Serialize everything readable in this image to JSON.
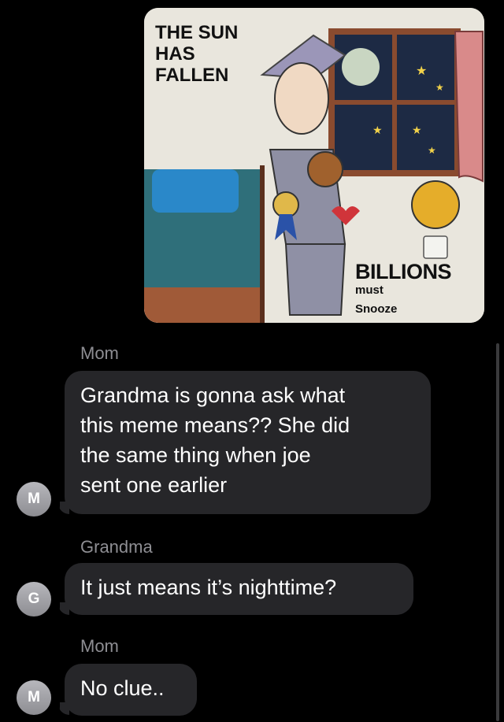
{
  "meme": {
    "title_lines": [
      "THE SUN",
      "HAS",
      "FALLEN"
    ],
    "billions": "BILLIONS",
    "must": "must",
    "snooze": "Snooze"
  },
  "messages": [
    {
      "sender": "Mom",
      "avatar_initial": "M",
      "lines": [
        "Grandma is gonna ask what",
        "this meme means?? She did",
        "the same thing when joe",
        "sent one earlier"
      ]
    },
    {
      "sender": "Grandma",
      "avatar_initial": "G",
      "lines": [
        "It just means it’s nighttime?"
      ]
    },
    {
      "sender": "Mom",
      "avatar_initial": "M",
      "lines": [
        "No clue.."
      ]
    }
  ],
  "colors": {
    "background": "#000000",
    "bubble": "#262629",
    "sender_text": "#8e8e93",
    "avatar": "#9f9fa4"
  }
}
